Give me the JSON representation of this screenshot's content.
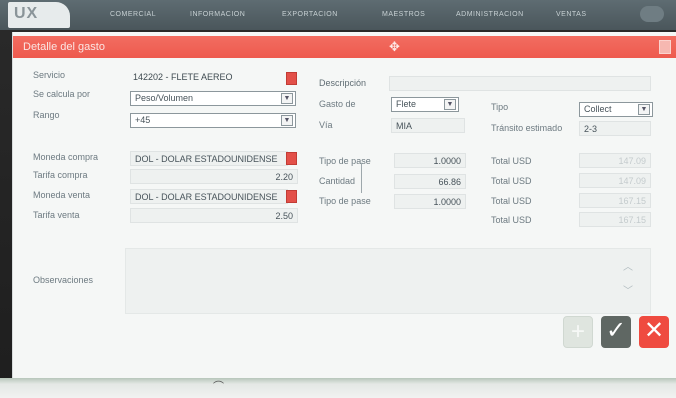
{
  "app": {
    "logo": "UX",
    "nav": [
      "COMERCIAL",
      "INFORMACION",
      "EXPORTACION",
      "MAESTROS",
      "ADMINISTRACION",
      "VENTAS"
    ]
  },
  "dialog": {
    "title": "Detalle del gasto",
    "left": {
      "servicio_label": "Servicio",
      "servicio_value": "142202 - FLETE AEREO",
      "calcula_label": "Se calcula por",
      "calcula_value": "Peso/Volumen",
      "rango_label": "Rango",
      "rango_value": "+45",
      "moneda_compra_label": "Moneda compra",
      "moneda_compra_value": "DOL - DOLAR ESTADOUNIDENSE",
      "tarifa_compra_label": "Tarifa compra",
      "tarifa_compra_value": "2.20",
      "moneda_venta_label": "Moneda venta",
      "moneda_venta_value": "DOL - DOLAR ESTADOUNIDENSE",
      "tarifa_venta_label": "Tarifa venta",
      "tarifa_venta_value": "2.50"
    },
    "middle": {
      "descripcion_label": "Descripción",
      "descripcion_value": "",
      "gasto_de_label": "Gasto de",
      "gasto_de_value": "Flete",
      "via_label": "Vía",
      "via_value": "MIA",
      "tipo_pase_label": "Tipo de pase",
      "tipo_pase_value": "1.0000",
      "cantidad_label": "Cantidad",
      "cantidad_value": "66.86",
      "tipo_pase2_label": "Tipo de pase",
      "tipo_pase2_value": "1.0000"
    },
    "right": {
      "tipo_label": "Tipo",
      "tipo_value": "Collect",
      "transito_label": "Tránsito estimado",
      "transito_value": "2-3",
      "totals": [
        {
          "label": "Total USD",
          "value": "147.09"
        },
        {
          "label": "Total USD",
          "value": "147.09"
        },
        {
          "label": "Total USD",
          "value": "167.15"
        },
        {
          "label": "Total USD",
          "value": "167.15"
        }
      ]
    },
    "observaciones_label": "Observaciones",
    "observaciones_value": "",
    "buttons": {
      "add": "+",
      "confirm": "✓",
      "cancel": "✕"
    }
  }
}
